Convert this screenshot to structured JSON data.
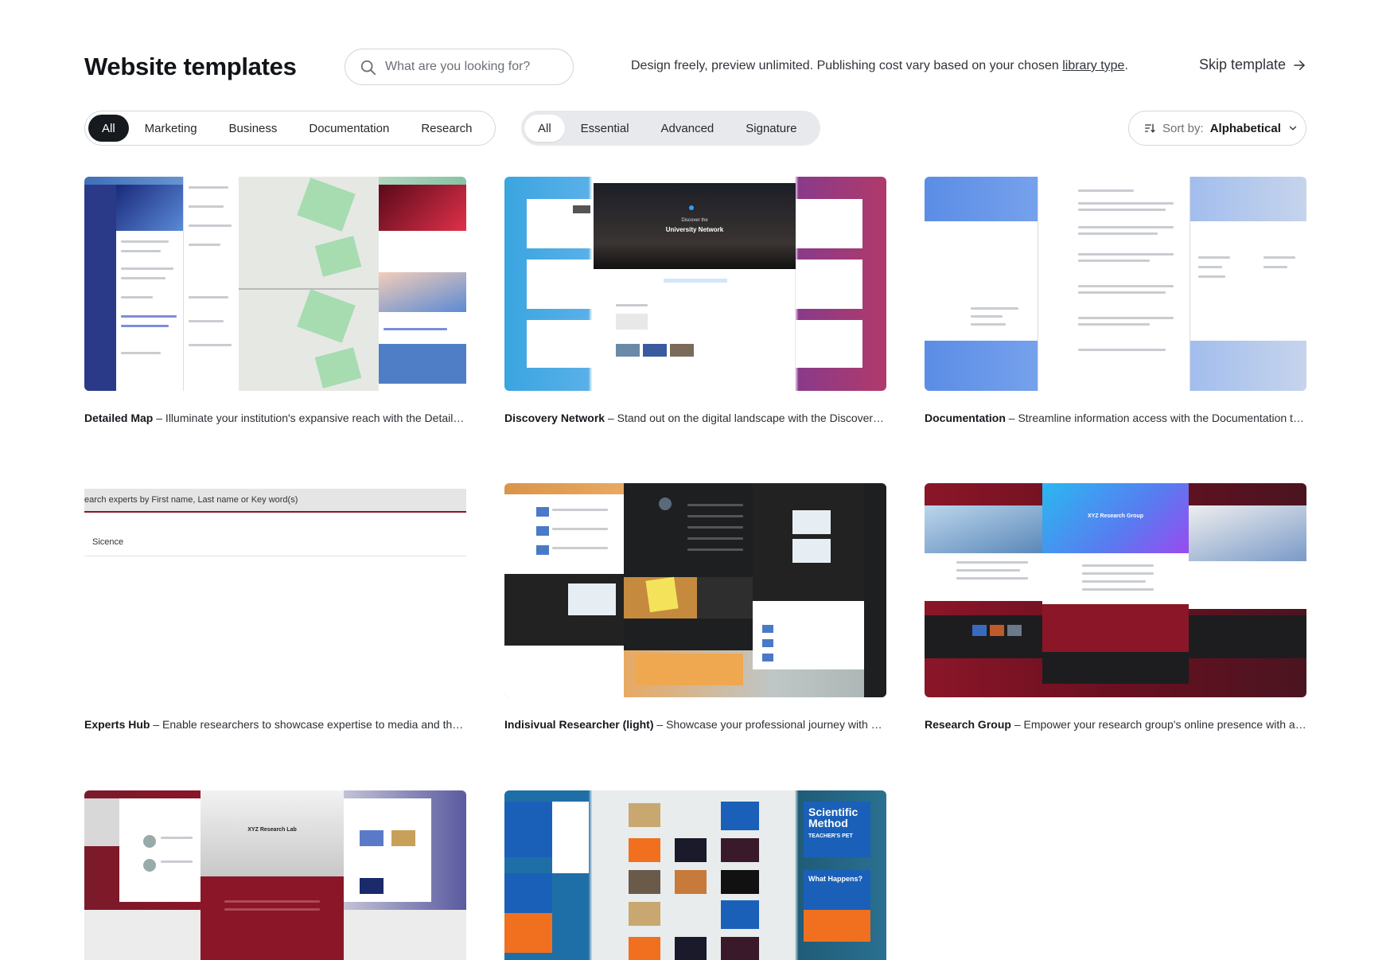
{
  "header": {
    "title": "Website templates",
    "search_placeholder": "What are you looking for?",
    "note_text": "Design freely, preview unlimited. Publishing cost vary based on your chosen ",
    "note_link": "library type",
    "note_end": ".",
    "skip_label": "Skip template"
  },
  "filters": {
    "categories": [
      "All",
      "Marketing",
      "Business",
      "Documentation",
      "Research"
    ],
    "active_category": "All",
    "tiers": [
      "All",
      "Essential",
      "Advanced",
      "Signature"
    ],
    "active_tier": "All",
    "sort_label": "Sort by:",
    "sort_value": "Alphabetical"
  },
  "templates": [
    {
      "name": "Detailed Map",
      "description": " – Illuminate your institution's expansive reach with the Detailed Map template"
    },
    {
      "name": "Discovery Network",
      "description": " – Stand out on the digital landscape with the Discovery Network template"
    },
    {
      "name": "Documentation",
      "description": " – Streamline information access with the Documentation template"
    },
    {
      "name": "Experts Hub",
      "description": " – Enable researchers to showcase expertise to media and the public"
    },
    {
      "name": "Indisivual Researcher (light)",
      "description": " – Showcase your professional journey with a personal site"
    },
    {
      "name": "Research Group",
      "description": " – Empower your research group's online presence with a modern site"
    },
    {
      "name": "",
      "description": ""
    },
    {
      "name": "",
      "description": ""
    }
  ],
  "thumbs": {
    "experts_search": "earch experts by First name, Last name or Key word(s)",
    "experts_item": "Sicence",
    "discovery_title": "University Network",
    "discovery_sub": "Discover the",
    "research_group_title": "XYZ Research Group",
    "research_lab_title": "XYZ Research Lab",
    "scientific_method_title": "Scientific Method",
    "teachers_pet": "TEACHER'S PET",
    "what_happens": "What Happens?"
  },
  "colors": {
    "accent_dark": "#16191d",
    "border": "#d3d6db",
    "tier_bg": "#e7e9ec",
    "maroon": "#8a1628",
    "sky": "#4aa3de"
  }
}
